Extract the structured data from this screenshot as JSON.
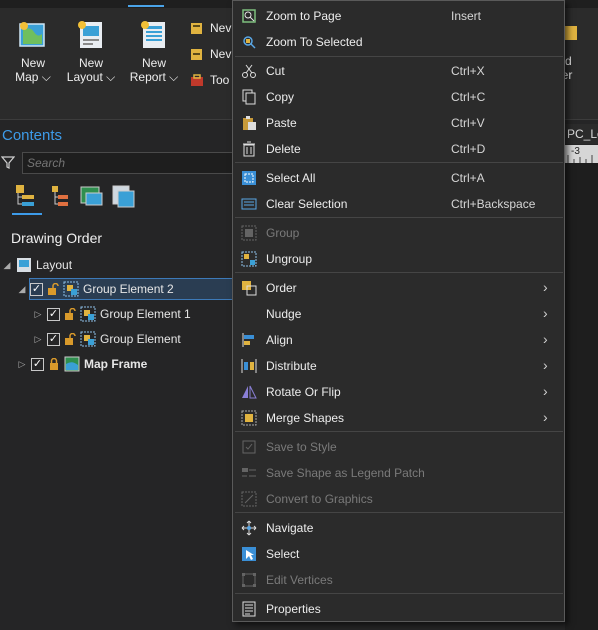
{
  "ribbon": {
    "buttons": [
      {
        "line1": "New",
        "line2": "Map ⌵"
      },
      {
        "line1": "New",
        "line2": "Layout ⌵"
      },
      {
        "line1": "New",
        "line2": "Report ⌵"
      }
    ],
    "small_items": [
      "Nev",
      "Nev",
      "Too"
    ],
    "right_partial": {
      "line1": "d",
      "line2": "der"
    }
  },
  "contents": {
    "title": "Contents",
    "search_placeholder": "Search",
    "section_title": "Drawing Order",
    "tree": [
      {
        "label": "Layout"
      },
      {
        "label": "Group Element 2"
      },
      {
        "label": "Group Element 1"
      },
      {
        "label": "Group Element"
      },
      {
        "label": "Map Frame"
      }
    ]
  },
  "ruler": {
    "tab_label": "PC_Lo",
    "tick_label": "-3"
  },
  "context_menu": {
    "items": [
      {
        "label": "Zoom to Page",
        "shortcut": "Insert",
        "icon": "zoom-page-icon"
      },
      {
        "label": "Zoom To Selected",
        "shortcut": "",
        "icon": "zoom-selected-icon"
      },
      {
        "label": "Cut",
        "shortcut": "Ctrl+X",
        "icon": "scissors-icon"
      },
      {
        "label": "Copy",
        "shortcut": "Ctrl+C",
        "icon": "copy-icon"
      },
      {
        "label": "Paste",
        "shortcut": "Ctrl+V",
        "icon": "paste-icon"
      },
      {
        "label": "Delete",
        "shortcut": "Ctrl+D",
        "icon": "trash-icon"
      },
      {
        "label": "Select All",
        "shortcut": "Ctrl+A",
        "icon": "select-all-icon"
      },
      {
        "label": "Clear Selection",
        "shortcut": "Ctrl+Backspace",
        "icon": "clear-selection-icon"
      },
      {
        "label": "Group",
        "shortcut": "",
        "icon": "group-icon",
        "disabled": true
      },
      {
        "label": "Ungroup",
        "shortcut": "",
        "icon": "ungroup-icon"
      },
      {
        "label": "Order",
        "shortcut": "",
        "icon": "order-icon",
        "submenu": true
      },
      {
        "label": "Nudge",
        "shortcut": "",
        "icon": "",
        "submenu": true
      },
      {
        "label": "Align",
        "shortcut": "",
        "icon": "align-icon",
        "submenu": true
      },
      {
        "label": "Distribute",
        "shortcut": "",
        "icon": "distribute-icon",
        "submenu": true
      },
      {
        "label": "Rotate Or Flip",
        "shortcut": "",
        "icon": "rotate-flip-icon",
        "submenu": true
      },
      {
        "label": "Merge Shapes",
        "shortcut": "",
        "icon": "merge-shapes-icon",
        "submenu": true
      },
      {
        "label": "Save to Style",
        "shortcut": "",
        "icon": "save-style-icon",
        "disabled": true
      },
      {
        "label": "Save Shape as Legend Patch",
        "shortcut": "",
        "icon": "legend-patch-icon",
        "disabled": true
      },
      {
        "label": "Convert to Graphics",
        "shortcut": "",
        "icon": "convert-graphics-icon",
        "disabled": true
      },
      {
        "label": "Navigate",
        "shortcut": "",
        "icon": "navigate-icon"
      },
      {
        "label": "Select",
        "shortcut": "",
        "icon": "select-cursor-icon"
      },
      {
        "label": "Edit Vertices",
        "shortcut": "",
        "icon": "edit-vertices-icon",
        "disabled": true
      },
      {
        "label": "Properties",
        "shortcut": "",
        "icon": "properties-icon"
      }
    ]
  },
  "colors": {
    "accent": "#3d9be9",
    "selection_bg": "#2a3d52",
    "menu_bg": "#2b2b2b"
  }
}
